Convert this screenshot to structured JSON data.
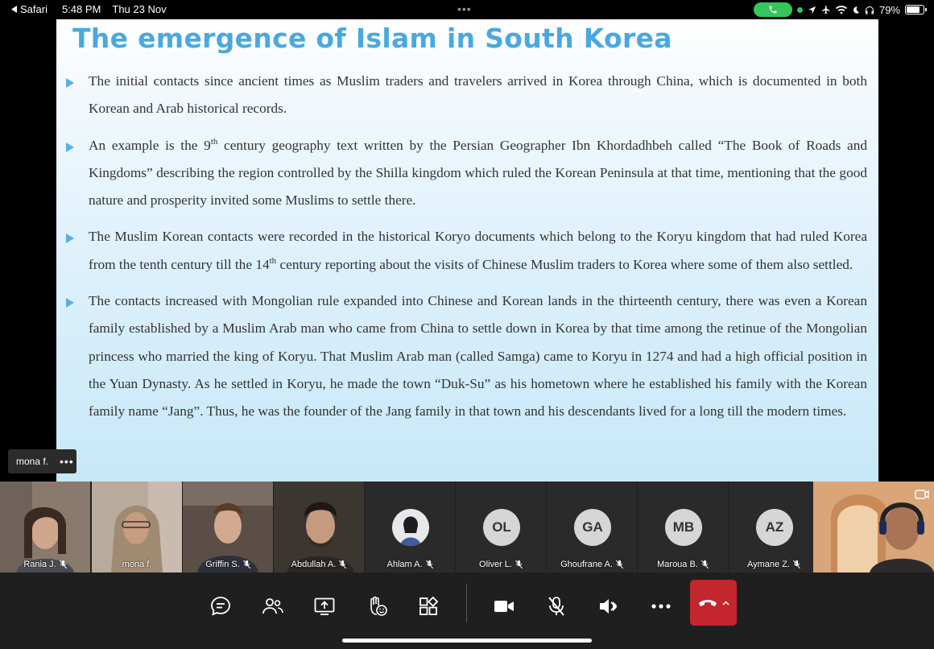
{
  "status_bar": {
    "back_app": "Safari",
    "time": "5:48 PM",
    "date": "Thu 23 Nov",
    "battery": "79%",
    "battery_level": 0.79,
    "icons": [
      "phone-icon",
      "location-icon",
      "airplane-icon",
      "wifi-icon",
      "moon-icon",
      "headphones-icon",
      "battery-icon"
    ]
  },
  "slide": {
    "title": "The emergence of Islam in South Korea",
    "bullets": [
      {
        "parts": [
          "The initial contacts since ancient times as Muslim traders and travelers arrived in Korea through China, which is documented in both Korean and Arab historical records."
        ]
      },
      {
        "parts": [
          "An example is the 9",
          "th",
          " century geography text written by the Persian Geographer Ibn Khordadhbeh called “The Book of Roads and Kingdoms” describing the region controlled by the Shilla kingdom which ruled the Korean Peninsula at that time, mentioning that the good nature and prosperity invited some Muslims to settle there."
        ]
      },
      {
        "parts": [
          "The Muslim Korean contacts were recorded in the historical Koryo documents which belong to the Koryu kingdom that had ruled Korea from the tenth century till the 14",
          "th",
          " century reporting about the visits of Chinese Muslim traders to Korea where some of them also settled."
        ]
      },
      {
        "parts": [
          "The contacts increased with Mongolian rule expanded into Chinese and Korean lands in the thirteenth century, there was even a Korean family established by a Muslim Arab man who came from China to settle down in Korea by that time among the retinue of the Mongolian princess who married the king of Koryu. That Muslim Arab man (called Samga) came to Koryu in 1274 and had a high official position in the Yuan Dynasty. As he settled in Koryu, he made the town “Duk-Su” as his hometown where he established his family with the Korean family name “Jang”. Thus, he was the founder of the Jang family in that town and his descendants lived for a long till the modern times."
        ]
      }
    ]
  },
  "speaker_tip": {
    "name": "mona f.",
    "more": "•••"
  },
  "participants": [
    {
      "name": "Rania J.",
      "type": "video",
      "muted": true
    },
    {
      "name": "mona f.",
      "type": "video",
      "muted": false,
      "selected": true
    },
    {
      "name": "Griffin S.",
      "type": "video",
      "muted": true
    },
    {
      "name": "Abdullah A.",
      "type": "video",
      "muted": true
    },
    {
      "name": "Ahlam A.",
      "type": "photo",
      "muted": true
    },
    {
      "name": "Oliver L.",
      "type": "initials",
      "initials": "OL",
      "muted": true
    },
    {
      "name": "Ghoufrane A.",
      "type": "initials",
      "initials": "GA",
      "muted": true
    },
    {
      "name": "Maroua B.",
      "type": "initials",
      "initials": "MB",
      "muted": true
    },
    {
      "name": "Aymane Z.",
      "type": "initials",
      "initials": "AZ",
      "muted": true
    },
    {
      "name": "",
      "type": "self",
      "muted": false
    }
  ],
  "toolbar": {
    "buttons": [
      "chat-icon",
      "participants-icon",
      "share-screen-icon",
      "reactions-icon",
      "apps-icon",
      "camera-icon",
      "mic-off-icon",
      "speaker-icon",
      "more-icon"
    ],
    "hangup": "hangup-icon"
  }
}
